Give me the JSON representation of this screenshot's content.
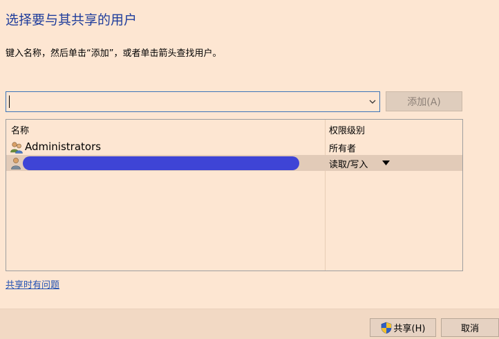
{
  "dialog": {
    "title": "选择要与其共享的用户",
    "instruction": "键入名称，然后单击“添加”，或者单击箭头查找用户。"
  },
  "entry": {
    "value": "",
    "add_button_label": "添加(A)"
  },
  "list": {
    "headers": {
      "name": "名称",
      "permission": "权限级别"
    },
    "rows": [
      {
        "name": "Administrators",
        "permission": "所有者",
        "icon": "group-users-icon"
      },
      {
        "name": "",
        "permission": "读取/写入",
        "icon": "user-icon",
        "selected": true
      }
    ]
  },
  "help": {
    "link_label": "共享时有问题"
  },
  "footer": {
    "share_label": "共享(H)",
    "cancel_label": "取消"
  },
  "colors": {
    "background": "#fde6d2",
    "title": "#1f3d9c",
    "link": "#1f4fb3",
    "focus_border": "#3a73b8",
    "selected_row": "#e2cbb8",
    "redaction": "#3e44d6"
  }
}
